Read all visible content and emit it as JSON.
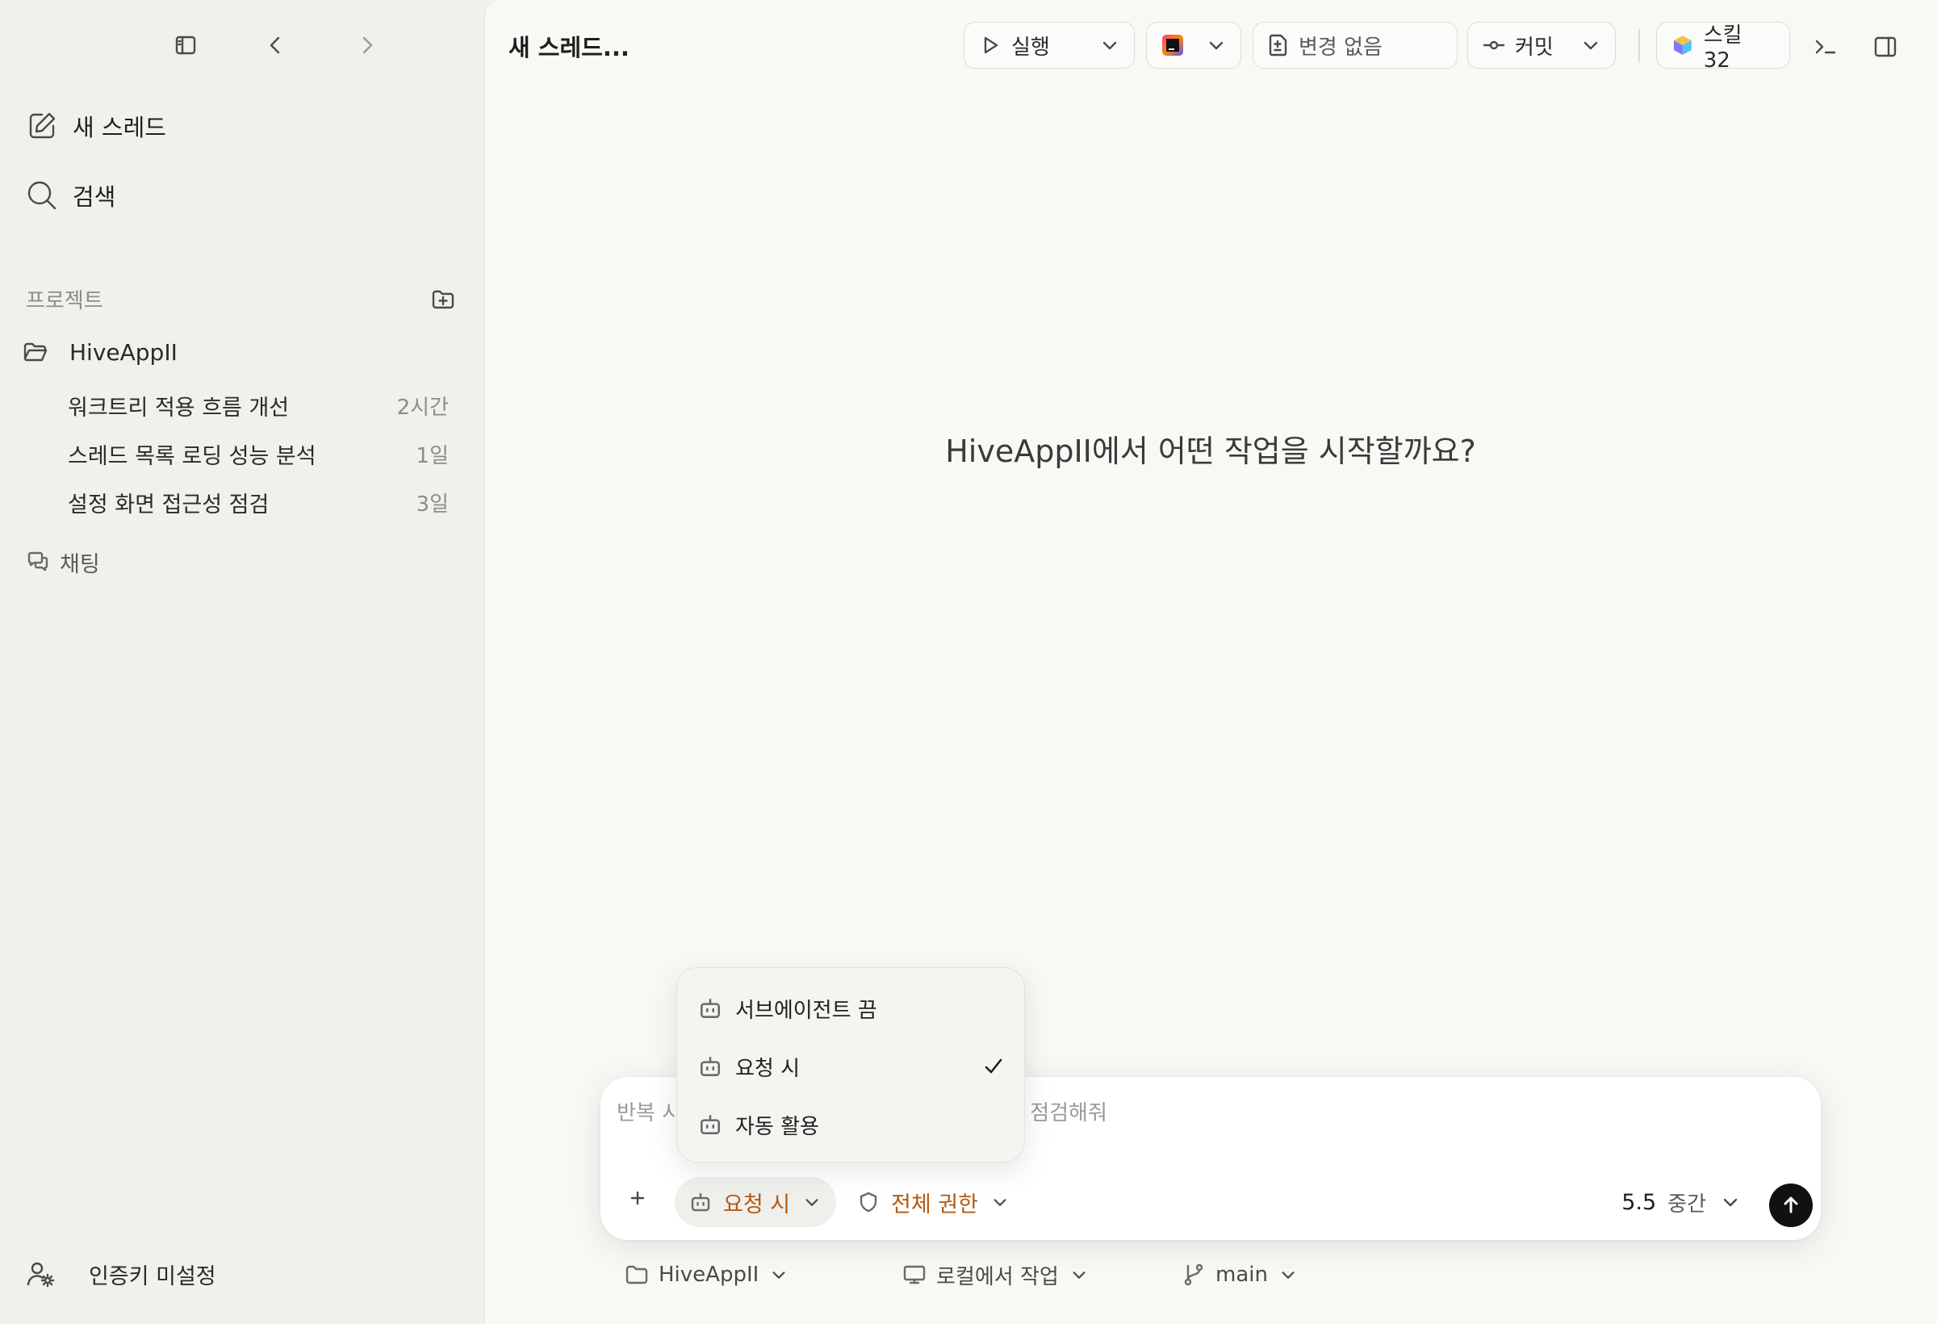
{
  "sidebar": {
    "new_thread": "새 스레드",
    "search": "검색",
    "projects_label": "프로젝트",
    "project": {
      "name": "HiveAppII",
      "threads": [
        {
          "title": "워크트리 적용 흐름 개선",
          "age": "2시간"
        },
        {
          "title": "스레드 목록 로딩 성능 분석",
          "age": "1일"
        },
        {
          "title": "설정 화면 접근성 점검",
          "age": "3일"
        }
      ]
    },
    "chat": "채팅",
    "auth_status": "인증키 미설정"
  },
  "header": {
    "title": "새 스레드...",
    "run_label": "실행",
    "changes_label": "변경 없음",
    "commit_label": "커밋",
    "skills_label": "스킬 32"
  },
  "main": {
    "prompt": "HiveAppII에서 어떤 작업을 시작할까요?"
  },
  "composer": {
    "placeholder_left": "반복 시",
    "placeholder_right": "을 점검해줘",
    "agent_mode": "요청 시",
    "permission": "전체 권한",
    "model_version": "5.5",
    "model_level": "중간"
  },
  "dropdown": {
    "items": [
      "서브에이전트 끔",
      "요청 시",
      "자동 활용"
    ],
    "selected": "요청 시"
  },
  "footer": {
    "project": "HiveAppII",
    "environment": "로컬에서 작업",
    "branch": "main"
  },
  "colors": {
    "accent": "#b55a10",
    "sidebar_bg": "#f0f0ec",
    "main_bg": "#f8f8f5"
  }
}
